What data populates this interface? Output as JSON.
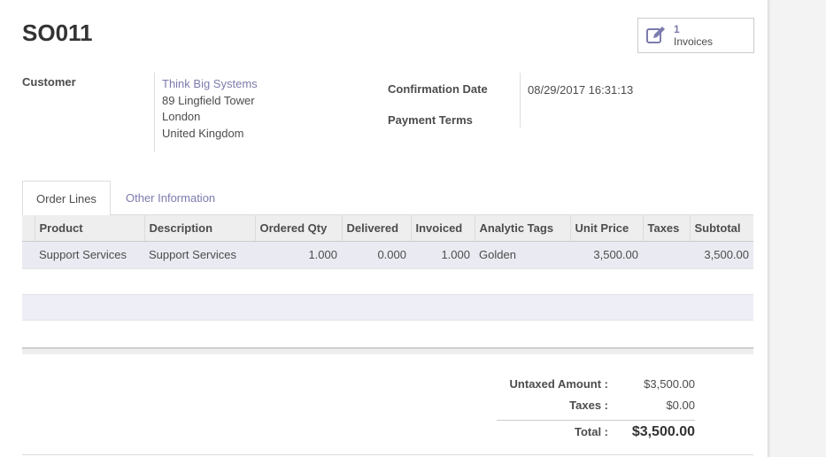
{
  "record": {
    "name": "SO011"
  },
  "smart_button": {
    "count": "1",
    "label": "Invoices",
    "icon": "edit-icon"
  },
  "customer": {
    "label": "Customer",
    "name": "Think Big Systems",
    "address_lines": [
      "89 Lingfield Tower",
      "London",
      "United Kingdom"
    ]
  },
  "confirmation": {
    "label": "Confirmation Date",
    "value": "08/29/2017 16:31:13"
  },
  "payment_terms": {
    "label": "Payment Terms"
  },
  "tabs": [
    {
      "label": "Order Lines",
      "active": true
    },
    {
      "label": "Other Information",
      "active": false
    }
  ],
  "order_lines": {
    "columns": [
      "Product",
      "Description",
      "Ordered Qty",
      "Delivered",
      "Invoiced",
      "Analytic Tags",
      "Unit Price",
      "Taxes",
      "Subtotal"
    ],
    "rows": [
      [
        "Support Services",
        "Support Services",
        "1.000",
        "0.000",
        "1.000",
        "Golden",
        "3,500.00",
        "",
        "3,500.00"
      ]
    ]
  },
  "totals": {
    "untaxed_label": "Untaxed Amount :",
    "untaxed_value": "$3,500.00",
    "taxes_label": "Taxes :",
    "taxes_value": "$0.00",
    "total_label": "Total :",
    "total_value": "$3,500.00"
  },
  "colors": {
    "accent": "#7c7bad",
    "row_highlight": "#eaeaf2"
  }
}
